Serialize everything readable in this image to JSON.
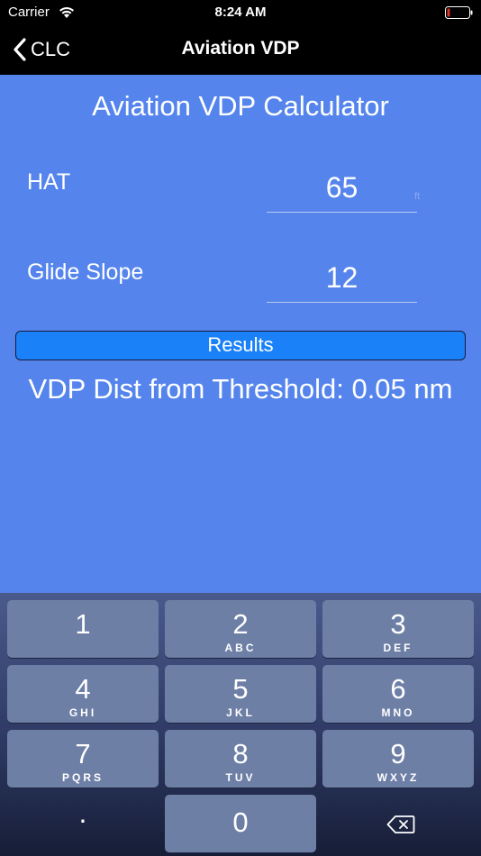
{
  "status_bar": {
    "carrier": "Carrier",
    "time": "8:24 AM"
  },
  "nav": {
    "back_label": "CLC",
    "title": "Aviation VDP"
  },
  "main": {
    "title": "Aviation VDP Calculator",
    "hat_label": "HAT",
    "hat_value": "65",
    "hat_unit": "ft",
    "glide_label": "Glide Slope",
    "glide_value": "12",
    "results_button": "Results",
    "result_text": "VDP Dist from Threshold: 0.05 nm"
  },
  "keyboard": {
    "keys": [
      {
        "num": "1",
        "letters": ""
      },
      {
        "num": "2",
        "letters": "ABC"
      },
      {
        "num": "3",
        "letters": "DEF"
      },
      {
        "num": "4",
        "letters": "GHI"
      },
      {
        "num": "5",
        "letters": "JKL"
      },
      {
        "num": "6",
        "letters": "MNO"
      },
      {
        "num": "7",
        "letters": "PQRS"
      },
      {
        "num": "8",
        "letters": "TUV"
      },
      {
        "num": "9",
        "letters": "WXYZ"
      }
    ],
    "dot": ".",
    "zero": "0"
  },
  "icons": {
    "wifi": "wifi-icon",
    "battery": "battery-low-icon",
    "back": "chevron-left-icon",
    "delete": "delete-backspace-icon"
  },
  "colors": {
    "background": "#5585ec",
    "results_button": "#1a81f9",
    "battery_low": "#e0342b"
  }
}
